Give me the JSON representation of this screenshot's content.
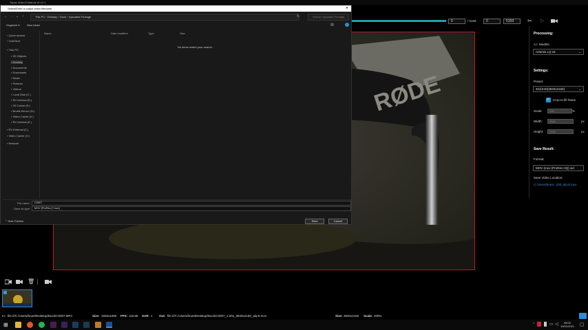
{
  "app": {
    "title": "Topaz Video Enhance AI v2.1"
  },
  "topbar": {
    "frame_start": "0",
    "frame_total_label": "/ 5159",
    "frame_current": "0",
    "frame_end": "5159"
  },
  "dialog": {
    "title": "Select/Enter a output video filename",
    "breadcrumb": "This PC  ›  Desktop  ›  Duck  ›  Upscaled Footage",
    "search_placeholder": "Search Upscaled Footage",
    "organize_label": "Organize ▾",
    "new_folder_label": "New folder",
    "nav_items": [
      {
        "label": "Quick access"
      },
      {
        "label": "OneDrive"
      },
      {
        "label": "This PC"
      },
      {
        "label": "3D Objects"
      },
      {
        "label": "Desktop"
      },
      {
        "label": "Documents"
      },
      {
        "label": "Downloads"
      },
      {
        "label": "Music"
      },
      {
        "label": "Pictures"
      },
      {
        "label": "Videos"
      },
      {
        "label": "Local Disk (C:)"
      },
      {
        "label": "RV Internal (D:)"
      },
      {
        "label": "3D Cache (E:)"
      },
      {
        "label": "Bruett-Server (N:)"
      },
      {
        "label": "Video Cache (V:)"
      },
      {
        "label": "RV Internal (Z:)"
      },
      {
        "label": "RV External (Z:)"
      },
      {
        "label": "Video Cache (V:)"
      },
      {
        "label": "Network"
      }
    ],
    "columns": [
      "Name",
      "Date modified",
      "Type",
      "Size"
    ],
    "empty_message": "No items match your search.",
    "file_name_label": "File name:",
    "file_name_value": "C0007",
    "save_type_label": "Save as type:",
    "save_type_value": "MOV (ProRes (*.mov)",
    "hide_folders_label": "Hide Folders",
    "save_button": "Save",
    "cancel_button": "Cancel"
  },
  "panel": {
    "processing_title": "Processing:",
    "ai_models_label": "A.I. Models:",
    "ai_model_value": "Artemis LQ v8",
    "settings_title": "Settings:",
    "preset_label": "Preset:",
    "preset_value": "4K(UHD(3840x2160)",
    "crop_label": "Crop to fill frame",
    "scale_label": "Scale:",
    "scale_value": "200",
    "scale_unit": "%",
    "width_label": "Width:",
    "width_value": "3840",
    "width_unit": "px",
    "height_label": "Height:",
    "height_value": "2160",
    "height_unit": "px",
    "save_result_title": "Save Result:",
    "format_label": "Format:",
    "format_value": "MOV (mov (ProRes HQ) vid",
    "save_location_label": "Save Video Location:",
    "save_location_value": "C:/Users/bruet...200_alq-8.mov"
  },
  "status": {
    "in_label": "In:",
    "in_value": "file:///C:/Users/bruet/Desktop/Duck/C0007.MP4",
    "size_label": "Size:",
    "size_value": "1920x1080",
    "fps_label": "FPS:",
    "fps_value": "119.88",
    "sar_label": "SAR:",
    "sar_value": "1",
    "out_label": "Out:",
    "out_value": "file:///C:/Users/bruet/Desktop/Duck/C0007_2.00x_3840x2160_alq-8.mov",
    "out_size_label": "Size:",
    "out_size_value": "3840x2160",
    "scale_label": "Scale:",
    "scale_value": "200%"
  },
  "taskbar": {
    "time": "08:02",
    "date": "10/01/2021"
  },
  "colors": {
    "accent_teal": "#1aa3a8",
    "video_border": "#c0162b",
    "link_blue": "#3b8de0"
  }
}
